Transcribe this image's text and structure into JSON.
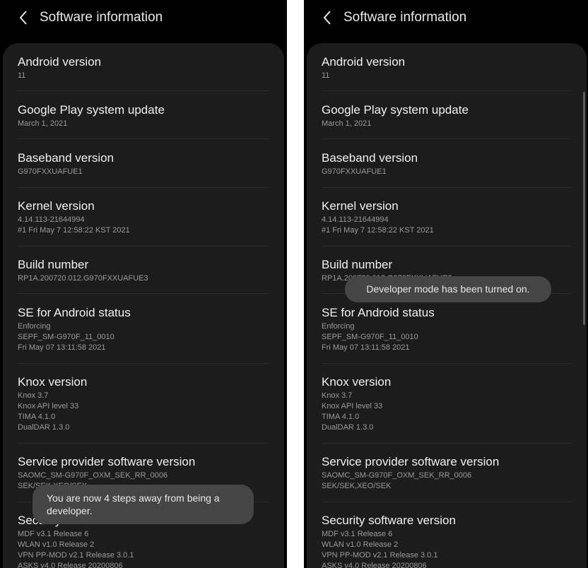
{
  "screen_title": "Software information",
  "items": [
    {
      "title": "Android version",
      "lines": [
        "11"
      ]
    },
    {
      "title": "Google Play system update",
      "lines": [
        "March 1, 2021"
      ]
    },
    {
      "title": "Baseband version",
      "lines": [
        "G970FXXUAFUE1"
      ]
    },
    {
      "title": "Kernel version",
      "lines": [
        "4.14.113-21644994",
        "#1 Fri May 7 12:58:22 KST 2021"
      ]
    },
    {
      "title": "Build number",
      "lines": [
        "RP1A.200720.012.G970FXXUAFUE3"
      ]
    },
    {
      "title": "SE for Android status",
      "lines": [
        "Enforcing",
        "SEPF_SM-G970F_11_0010",
        "Fri May 07 13:11:58 2021"
      ]
    },
    {
      "title": "Knox version",
      "lines": [
        "Knox 3.7",
        "Knox API level 33",
        "TIMA 4.1.0",
        "DualDAR 1.3.0"
      ]
    },
    {
      "title": "Service provider software version",
      "lines": [
        "SAOMC_SM-G970F_OXM_SEK_RR_0006",
        "SEK/SEK,XEO/SEK"
      ]
    },
    {
      "title": "Security software version",
      "lines": [
        "MDF v3.1 Release 6",
        "WLAN v1.0 Release 2",
        "VPN PP-MOD v2.1 Release 3.0.1",
        "ASKS v4.0 Release 20200806"
      ]
    }
  ],
  "toast_left": "You are now 4 steps away from being a developer.",
  "toast_right": "Developer mode has been turned on.",
  "colors": {
    "background": "#000000",
    "card": "#1c1c1c",
    "toast": "#454545"
  },
  "icons": {
    "back": "chevron-left-icon"
  }
}
